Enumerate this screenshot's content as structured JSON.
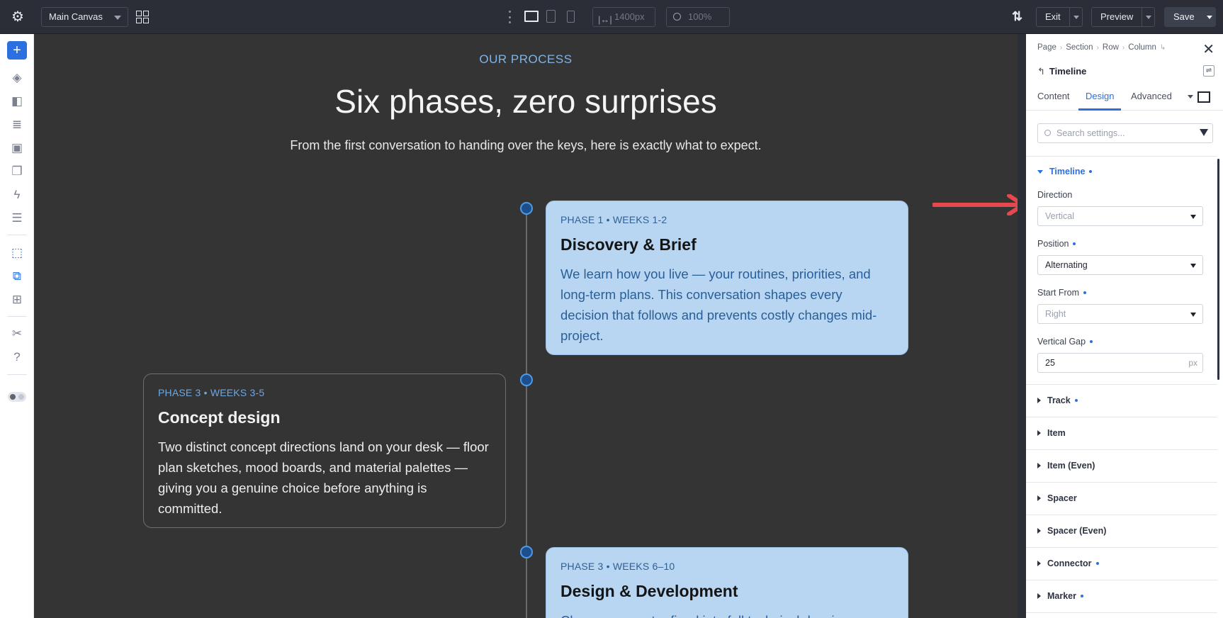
{
  "topbar": {
    "canvas_label": "Main Canvas",
    "width_value": "1400px",
    "zoom_value": "100%",
    "exit_label": "Exit",
    "preview_label": "Preview",
    "save_label": "Save"
  },
  "canvas": {
    "eyebrow": "OUR PROCESS",
    "heading": "Six phases, zero surprises",
    "subtext": "From the first conversation to handing over the keys, here is exactly what to expect.",
    "cards": [
      {
        "phase": "PHASE 1 • WEEKS 1-2",
        "title": "Discovery & Brief",
        "body": "We learn how you live — your routines, priorities, and long-term plans. This conversation shapes every decision that follows and prevents costly changes mid-project."
      },
      {
        "phase": "PHASE 3 • WEEKS 3-5",
        "title": "Concept design",
        "body": "Two distinct concept directions land on your desk — floor plan sketches, mood boards, and material palettes — giving you a genuine choice before anything is committed."
      },
      {
        "phase": "PHASE 3 • WEEKS 6–10",
        "title": "Design & Development",
        "body": "Chosen concept refined into full technical drawings"
      }
    ]
  },
  "panel": {
    "breadcrumbs": [
      "Page",
      "Section",
      "Row",
      "Column"
    ],
    "module_title": "Timeline",
    "tabs": [
      "Content",
      "Design",
      "Advanced"
    ],
    "active_tab": "Design",
    "search_placeholder": "Search settings...",
    "open_section": "Timeline",
    "fields": {
      "direction_label": "Direction",
      "direction_value": "Vertical",
      "position_label": "Position",
      "position_value": "Alternating",
      "start_label": "Start From",
      "start_value": "Right",
      "gap_label": "Vertical Gap",
      "gap_value": "25",
      "gap_unit": "px"
    },
    "sections": [
      "Track",
      "Item",
      "Item (Even)",
      "Spacer",
      "Spacer (Even)",
      "Connector",
      "Marker"
    ]
  },
  "colors": {
    "accent": "#2b6fe0",
    "card_light": "#b8d6f2",
    "arrow": "#e5484d"
  }
}
